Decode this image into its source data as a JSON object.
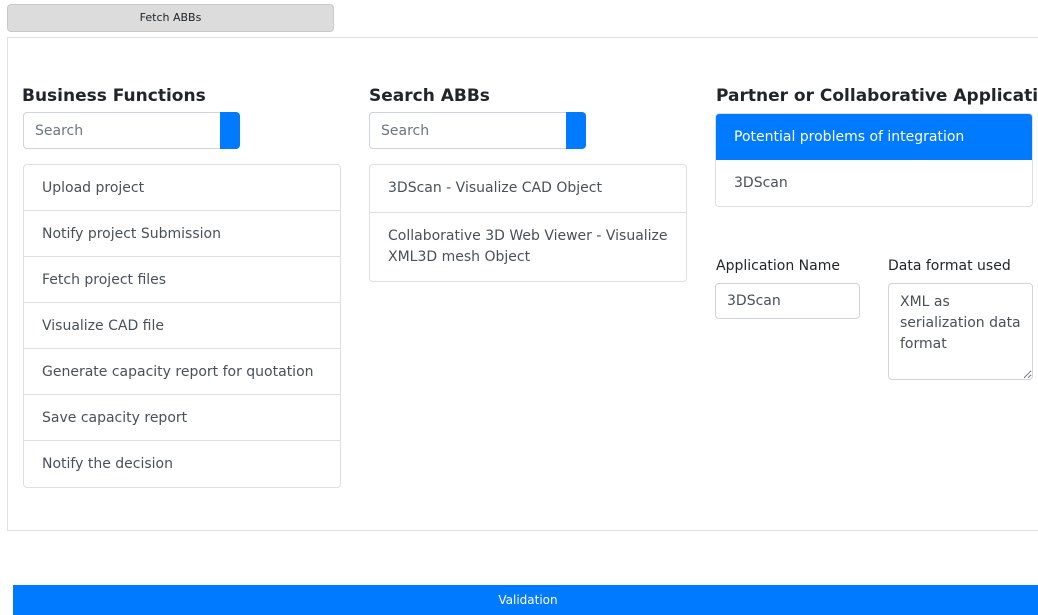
{
  "toolbar": {
    "fetch_label": "Fetch ABBs"
  },
  "business_functions": {
    "title": "Business Functions",
    "search_placeholder": "Search",
    "items": [
      {
        "label": "Upload project"
      },
      {
        "label": "Notify project Submission"
      },
      {
        "label": "Fetch project files"
      },
      {
        "label": "Visualize CAD file"
      },
      {
        "label": "Generate capacity report for quotation"
      },
      {
        "label": "Save capacity report"
      },
      {
        "label": "Notify the decision"
      }
    ]
  },
  "abbs": {
    "title": "Search ABBs",
    "search_placeholder": "Search",
    "items": [
      {
        "label": "3DScan - Visualize CAD Object"
      },
      {
        "label": "Collaborative 3D Web Viewer - Visualize XML3D mesh Object"
      }
    ]
  },
  "partners": {
    "title": "Partner or Collaborative Applications",
    "items": [
      {
        "label": "Potential problems of integration",
        "active": true
      },
      {
        "label": "3DScan",
        "active": false
      }
    ]
  },
  "details": {
    "app_name_label": "Application Name",
    "app_name_value": "3DScan",
    "data_format_label": "Data format used",
    "data_format_value": "XML as serialization data format"
  },
  "footer": {
    "validation_label": "Validation"
  },
  "colors": {
    "primary": "#007bff",
    "border": "#dfdfdf",
    "fetch_bg": "#dcdcdc"
  }
}
